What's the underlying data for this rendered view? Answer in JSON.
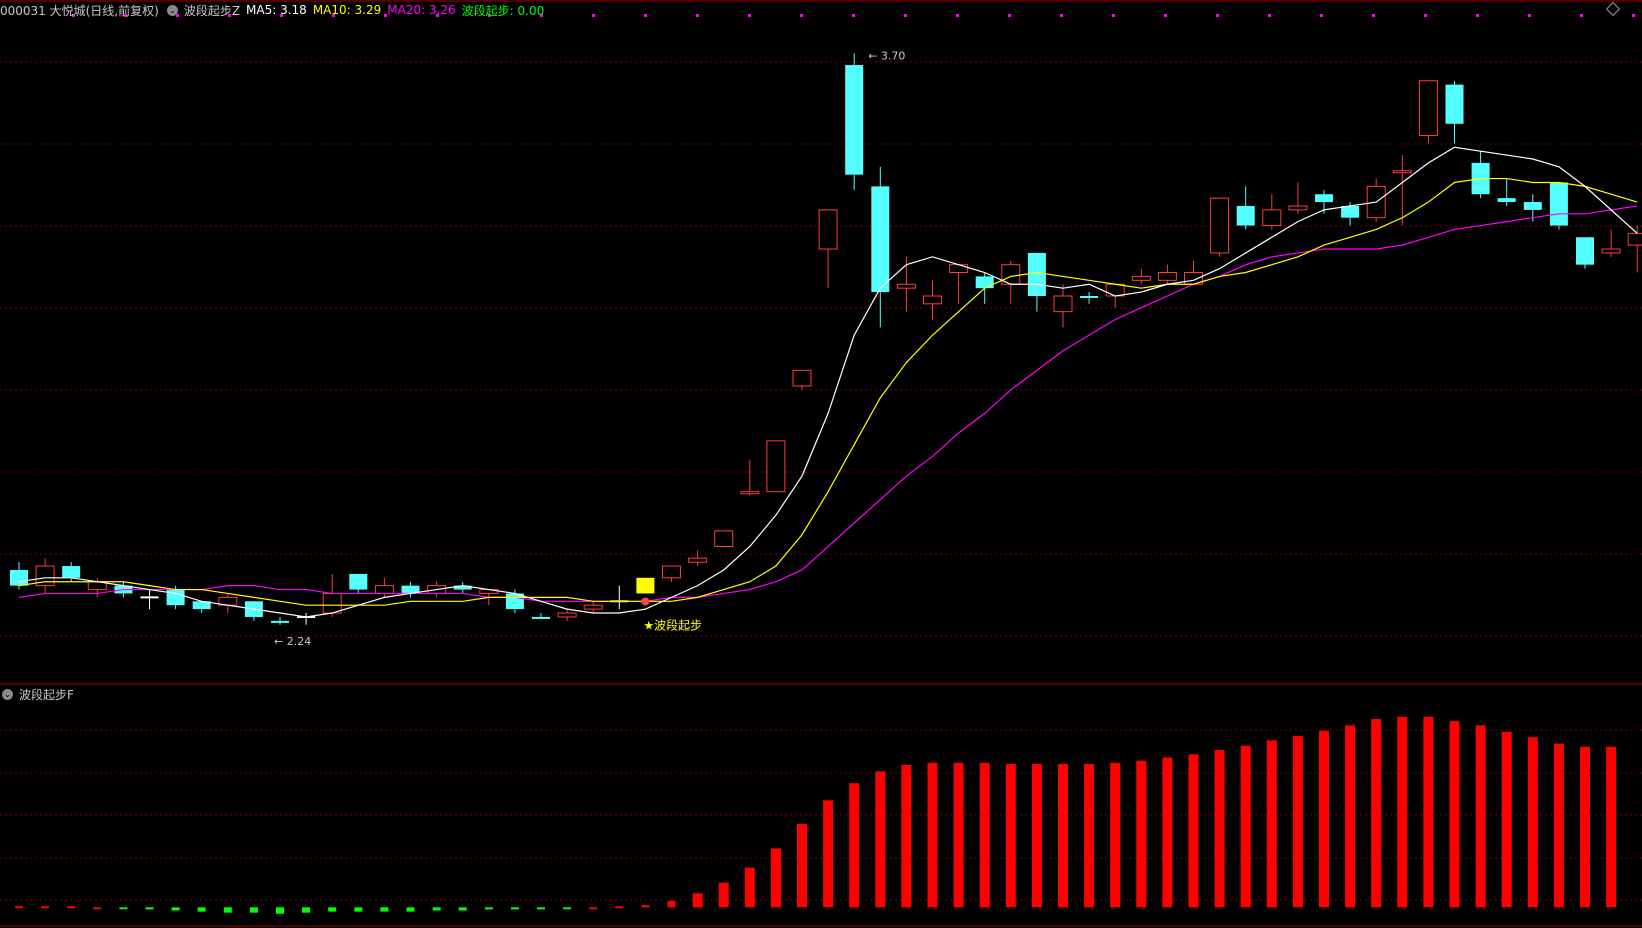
{
  "header": {
    "stock": "000031 大悦城(日线,前复权)",
    "indicator_name": "波段起步Z",
    "ma5_label": "MA5: 3.18",
    "ma10_label": "MA10: 3.29",
    "ma20_label": "MA20: 3.26",
    "signal_label": "波段起步: 0.00"
  },
  "sub_header": {
    "title": "波段起步F"
  },
  "annotations": {
    "high_label": "3.70",
    "low_label": "2.24",
    "signal_text": "★波段起步"
  },
  "colors": {
    "up": "#ff3b3b",
    "down": "#54ffff",
    "signal_candle": "#ffff00",
    "ma5": "#ffffff",
    "ma10": "#ffff00",
    "ma20": "#ff00ff",
    "grid": "#7a0000",
    "bar_pos": "#ff0000",
    "bar_neg": "#00ff00"
  },
  "chart_data": {
    "type": "candlestick",
    "price_range": [
      2.15,
      3.78
    ],
    "candles": [
      {
        "o": 2.38,
        "h": 2.4,
        "l": 2.33,
        "c": 2.34,
        "t": "down"
      },
      {
        "o": 2.34,
        "h": 2.41,
        "l": 2.32,
        "c": 2.39,
        "t": "up"
      },
      {
        "o": 2.39,
        "h": 2.4,
        "l": 2.35,
        "c": 2.36,
        "t": "down"
      },
      {
        "o": 2.33,
        "h": 2.36,
        "l": 2.31,
        "c": 2.35,
        "t": "up"
      },
      {
        "o": 2.34,
        "h": 2.35,
        "l": 2.31,
        "c": 2.32,
        "t": "down"
      },
      {
        "o": 2.3,
        "h": 2.33,
        "l": 2.28,
        "c": 2.31,
        "t": "doji"
      },
      {
        "o": 2.33,
        "h": 2.34,
        "l": 2.28,
        "c": 2.29,
        "t": "down"
      },
      {
        "o": 2.3,
        "h": 2.3,
        "l": 2.27,
        "c": 2.28,
        "t": "down"
      },
      {
        "o": 2.29,
        "h": 2.32,
        "l": 2.27,
        "c": 2.31,
        "t": "up"
      },
      {
        "o": 2.3,
        "h": 2.3,
        "l": 2.25,
        "c": 2.26,
        "t": "down"
      },
      {
        "o": 2.25,
        "h": 2.26,
        "l": 2.24,
        "c": 2.25,
        "t": "down"
      },
      {
        "o": 2.25,
        "h": 2.27,
        "l": 2.24,
        "c": 2.26,
        "t": "doji"
      },
      {
        "o": 2.27,
        "h": 2.37,
        "l": 2.26,
        "c": 2.32,
        "t": "up"
      },
      {
        "o": 2.37,
        "h": 2.37,
        "l": 2.32,
        "c": 2.33,
        "t": "down"
      },
      {
        "o": 2.32,
        "h": 2.36,
        "l": 2.31,
        "c": 2.34,
        "t": "up"
      },
      {
        "o": 2.34,
        "h": 2.35,
        "l": 2.31,
        "c": 2.32,
        "t": "down"
      },
      {
        "o": 2.32,
        "h": 2.35,
        "l": 2.31,
        "c": 2.34,
        "t": "up"
      },
      {
        "o": 2.34,
        "h": 2.35,
        "l": 2.32,
        "c": 2.33,
        "t": "down"
      },
      {
        "o": 2.32,
        "h": 2.33,
        "l": 2.29,
        "c": 2.33,
        "t": "up"
      },
      {
        "o": 2.32,
        "h": 2.33,
        "l": 2.27,
        "c": 2.28,
        "t": "down"
      },
      {
        "o": 2.26,
        "h": 2.27,
        "l": 2.26,
        "c": 2.26,
        "t": "down"
      },
      {
        "o": 2.26,
        "h": 2.28,
        "l": 2.25,
        "c": 2.27,
        "t": "up"
      },
      {
        "o": 2.28,
        "h": 2.3,
        "l": 2.27,
        "c": 2.29,
        "t": "up"
      },
      {
        "o": 2.29,
        "h": 2.34,
        "l": 2.28,
        "c": 2.3,
        "t": "doji"
      },
      {
        "o": 2.32,
        "h": 2.36,
        "l": 2.32,
        "c": 2.36,
        "t": "signal"
      },
      {
        "o": 2.36,
        "h": 2.39,
        "l": 2.35,
        "c": 2.39,
        "t": "up"
      },
      {
        "o": 2.4,
        "h": 2.43,
        "l": 2.39,
        "c": 2.41,
        "t": "up"
      },
      {
        "o": 2.44,
        "h": 2.48,
        "l": 2.44,
        "c": 2.48,
        "t": "up"
      },
      {
        "o": 2.58,
        "h": 2.66,
        "l": 2.57,
        "c": 2.58,
        "t": "up"
      },
      {
        "o": 2.58,
        "h": 2.71,
        "l": 2.58,
        "c": 2.71,
        "t": "up"
      },
      {
        "o": 2.85,
        "h": 2.89,
        "l": 2.84,
        "c": 2.89,
        "t": "up"
      },
      {
        "o": 3.2,
        "h": 3.3,
        "l": 3.1,
        "c": 3.3,
        "t": "up"
      },
      {
        "o": 3.67,
        "h": 3.7,
        "l": 3.35,
        "c": 3.39,
        "t": "down"
      },
      {
        "o": 3.36,
        "h": 3.41,
        "l": 3.0,
        "c": 3.09,
        "t": "down"
      },
      {
        "o": 3.1,
        "h": 3.18,
        "l": 3.04,
        "c": 3.11,
        "t": "up"
      },
      {
        "o": 3.06,
        "h": 3.12,
        "l": 3.02,
        "c": 3.08,
        "t": "up"
      },
      {
        "o": 3.14,
        "h": 3.16,
        "l": 3.06,
        "c": 3.16,
        "t": "up"
      },
      {
        "o": 3.13,
        "h": 3.14,
        "l": 3.06,
        "c": 3.1,
        "t": "down"
      },
      {
        "o": 3.16,
        "h": 3.17,
        "l": 3.06,
        "c": 3.11,
        "t": "up"
      },
      {
        "o": 3.19,
        "h": 3.19,
        "l": 3.04,
        "c": 3.08,
        "t": "down"
      },
      {
        "o": 3.04,
        "h": 3.11,
        "l": 3.0,
        "c": 3.08,
        "t": "up"
      },
      {
        "o": 3.08,
        "h": 3.09,
        "l": 3.06,
        "c": 3.08,
        "t": "down"
      },
      {
        "o": 3.08,
        "h": 3.1,
        "l": 3.05,
        "c": 3.11,
        "t": "up"
      },
      {
        "o": 3.12,
        "h": 3.15,
        "l": 3.11,
        "c": 3.13,
        "t": "up"
      },
      {
        "o": 3.12,
        "h": 3.16,
        "l": 3.11,
        "c": 3.14,
        "t": "up"
      },
      {
        "o": 3.11,
        "h": 3.17,
        "l": 3.11,
        "c": 3.14,
        "t": "up"
      },
      {
        "o": 3.19,
        "h": 3.33,
        "l": 3.18,
        "c": 3.33,
        "t": "up"
      },
      {
        "o": 3.31,
        "h": 3.36,
        "l": 3.25,
        "c": 3.26,
        "t": "down"
      },
      {
        "o": 3.26,
        "h": 3.34,
        "l": 3.25,
        "c": 3.3,
        "t": "up"
      },
      {
        "o": 3.3,
        "h": 3.37,
        "l": 3.29,
        "c": 3.31,
        "t": "up"
      },
      {
        "o": 3.34,
        "h": 3.35,
        "l": 3.29,
        "c": 3.32,
        "t": "down"
      },
      {
        "o": 3.31,
        "h": 3.32,
        "l": 3.26,
        "c": 3.28,
        "t": "down"
      },
      {
        "o": 3.28,
        "h": 3.38,
        "l": 3.27,
        "c": 3.36,
        "t": "up"
      },
      {
        "o": 3.4,
        "h": 3.44,
        "l": 3.26,
        "c": 3.4,
        "t": "up"
      },
      {
        "o": 3.49,
        "h": 3.62,
        "l": 3.47,
        "c": 3.63,
        "t": "up"
      },
      {
        "o": 3.62,
        "h": 3.63,
        "l": 3.47,
        "c": 3.52,
        "t": "down"
      },
      {
        "o": 3.42,
        "h": 3.45,
        "l": 3.33,
        "c": 3.34,
        "t": "down"
      },
      {
        "o": 3.33,
        "h": 3.38,
        "l": 3.31,
        "c": 3.32,
        "t": "down"
      },
      {
        "o": 3.32,
        "h": 3.34,
        "l": 3.27,
        "c": 3.3,
        "t": "down"
      },
      {
        "o": 3.37,
        "h": 3.37,
        "l": 3.25,
        "c": 3.26,
        "t": "down"
      },
      {
        "o": 3.23,
        "h": 3.23,
        "l": 3.15,
        "c": 3.16,
        "t": "down"
      },
      {
        "o": 3.19,
        "h": 3.25,
        "l": 3.18,
        "c": 3.2,
        "t": "up"
      },
      {
        "o": 3.21,
        "h": 3.26,
        "l": 3.14,
        "c": 3.24,
        "t": "up"
      }
    ],
    "ma5": [
      2.35,
      2.36,
      2.36,
      2.35,
      2.34,
      2.33,
      2.32,
      2.3,
      2.29,
      2.28,
      2.27,
      2.26,
      2.27,
      2.29,
      2.31,
      2.32,
      2.33,
      2.34,
      2.33,
      2.32,
      2.3,
      2.28,
      2.27,
      2.27,
      2.28,
      2.31,
      2.34,
      2.38,
      2.44,
      2.52,
      2.62,
      2.78,
      2.98,
      3.1,
      3.16,
      3.18,
      3.16,
      3.14,
      3.11,
      3.11,
      3.1,
      3.11,
      3.08,
      3.09,
      3.11,
      3.12,
      3.15,
      3.19,
      3.23,
      3.27,
      3.3,
      3.31,
      3.32,
      3.37,
      3.42,
      3.46,
      3.45,
      3.44,
      3.43,
      3.41,
      3.36,
      3.3,
      3.24
    ],
    "ma10": [
      2.34,
      2.35,
      2.35,
      2.35,
      2.35,
      2.34,
      2.33,
      2.33,
      2.32,
      2.31,
      2.3,
      2.29,
      2.29,
      2.29,
      2.29,
      2.3,
      2.3,
      2.3,
      2.31,
      2.31,
      2.31,
      2.31,
      2.3,
      2.3,
      2.3,
      2.3,
      2.31,
      2.33,
      2.35,
      2.39,
      2.47,
      2.58,
      2.7,
      2.82,
      2.91,
      2.98,
      3.04,
      3.1,
      3.13,
      3.14,
      3.13,
      3.12,
      3.11,
      3.1,
      3.11,
      3.11,
      3.13,
      3.14,
      3.16,
      3.18,
      3.21,
      3.23,
      3.25,
      3.28,
      3.32,
      3.37,
      3.38,
      3.38,
      3.37,
      3.37,
      3.36,
      3.34,
      3.32
    ],
    "ma20": [
      2.31,
      2.32,
      2.32,
      2.32,
      2.33,
      2.33,
      2.33,
      2.33,
      2.34,
      2.34,
      2.33,
      2.33,
      2.32,
      2.32,
      2.32,
      2.32,
      2.32,
      2.32,
      2.31,
      2.31,
      2.3,
      2.3,
      2.3,
      2.3,
      2.3,
      2.31,
      2.31,
      2.32,
      2.33,
      2.35,
      2.38,
      2.44,
      2.5,
      2.56,
      2.62,
      2.67,
      2.73,
      2.78,
      2.84,
      2.89,
      2.94,
      2.98,
      3.02,
      3.05,
      3.08,
      3.11,
      3.13,
      3.16,
      3.18,
      3.19,
      3.2,
      3.2,
      3.2,
      3.21,
      3.23,
      3.25,
      3.26,
      3.27,
      3.28,
      3.29,
      3.29,
      3.3,
      3.31
    ],
    "signal_values": [
      1,
      1,
      1,
      0,
      -1,
      -2,
      -3,
      -4,
      -5,
      -5,
      -6,
      -5,
      -4,
      -4,
      -4,
      -4,
      -3,
      -3,
      -2,
      -2,
      -2,
      -1,
      0,
      1,
      2,
      6,
      13,
      23,
      37,
      55,
      78,
      100,
      116,
      127,
      133,
      135,
      135,
      135,
      134,
      134,
      134,
      134,
      135,
      137,
      140,
      143,
      147,
      151,
      156,
      160,
      165,
      170,
      176,
      178,
      178,
      174,
      170,
      164,
      159,
      153,
      150,
      150
    ],
    "signal_range": [
      -10,
      190
    ]
  }
}
